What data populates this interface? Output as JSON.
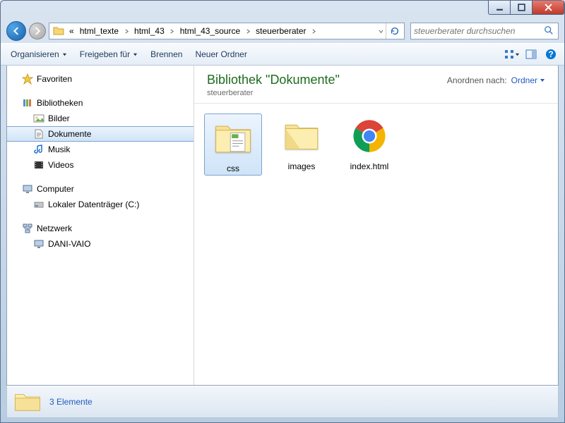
{
  "breadcrumb": {
    "chevrons": "«",
    "segments": [
      "html_texte",
      "html_43",
      "html_43_source",
      "steuerberater"
    ]
  },
  "search": {
    "placeholder": "steuerberater durchsuchen"
  },
  "toolbar": {
    "organize": "Organisieren",
    "share": "Freigeben für",
    "burn": "Brennen",
    "new_folder": "Neuer Ordner"
  },
  "sidebar": {
    "favorites": "Favoriten",
    "libraries": "Bibliotheken",
    "lib_items": [
      "Bilder",
      "Dokumente",
      "Musik",
      "Videos"
    ],
    "computer": "Computer",
    "disk": "Lokaler Datenträger (C:)",
    "network": "Netzwerk",
    "network_pc": "DANI-VAIO"
  },
  "content": {
    "library_title": "Bibliothek \"Dokumente\"",
    "library_sub": "steuerberater",
    "arrange_label": "Anordnen nach:",
    "arrange_value": "Ordner",
    "items": [
      {
        "name": "css",
        "type": "folder-files"
      },
      {
        "name": "images",
        "type": "folder"
      },
      {
        "name": "index.html",
        "type": "chrome"
      }
    ]
  },
  "status": {
    "text": "3 Elemente"
  }
}
